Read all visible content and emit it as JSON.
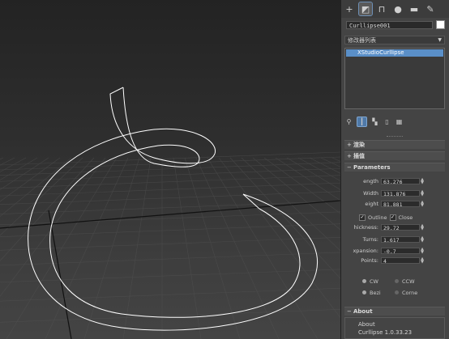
{
  "viewport": {
    "curve_color": "#ffffff",
    "grid_color": "#555555",
    "axis_color": "#111111"
  },
  "tabs": [
    {
      "icon": "plus-icon",
      "glyph": "+"
    },
    {
      "icon": "modify-icon",
      "glyph": "◩"
    },
    {
      "icon": "hierarchy-icon",
      "glyph": "⊓"
    },
    {
      "icon": "motion-icon",
      "glyph": "●"
    },
    {
      "icon": "display-icon",
      "glyph": "▬"
    },
    {
      "icon": "utilities-icon",
      "glyph": "✎"
    }
  ],
  "object_name": "Curllipse001",
  "object_color": "#ffffff",
  "modifier_list_label": "修改器列表",
  "stack_item": "XStudioCurllipse",
  "rollouts": {
    "render": "渲染",
    "interpolation": "插值",
    "parameters": "Parameters",
    "about": "About"
  },
  "params": {
    "length_label": "ength",
    "length_value": "63.276",
    "width_label": "Width",
    "width_value": "131.876",
    "height_label": "eight",
    "height_value": "81.881",
    "outline_label": "Outline",
    "close_label": "Close",
    "thickness_label": "hickness:",
    "thickness_value": "29.72",
    "turns_label": "Turns:",
    "turns_value": "1.617",
    "expansion_label": "xpansion:",
    "expansion_value": "-0.7",
    "points_label": "Points:",
    "points_value": "4"
  },
  "direction": {
    "cw": "CW",
    "ccw": "CCW"
  },
  "mode": {
    "bezier": "Bezi",
    "corner": "Corne"
  },
  "about": {
    "line1": "About",
    "line2": "Curllipse 1.0.33.23"
  }
}
